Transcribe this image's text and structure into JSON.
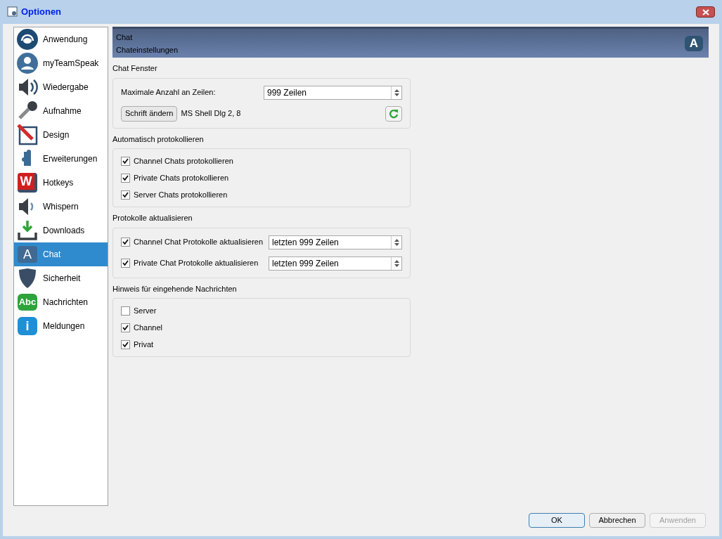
{
  "window": {
    "title": "Optionen"
  },
  "sidebar": {
    "items": [
      {
        "label": "Anwendung",
        "selected": false
      },
      {
        "label": "myTeamSpeak",
        "selected": false
      },
      {
        "label": "Wiedergabe",
        "selected": false
      },
      {
        "label": "Aufnahme",
        "selected": false
      },
      {
        "label": "Design",
        "selected": false
      },
      {
        "label": "Erweiterungen",
        "selected": false
      },
      {
        "label": "Hotkeys",
        "selected": false,
        "glyph": "W"
      },
      {
        "label": "Whispern",
        "selected": false
      },
      {
        "label": "Downloads",
        "selected": false
      },
      {
        "label": "Chat",
        "selected": true,
        "glyph": "A"
      },
      {
        "label": "Sicherheit",
        "selected": false
      },
      {
        "label": "Nachrichten",
        "selected": false,
        "glyph": "Abc"
      },
      {
        "label": "Meldungen",
        "selected": false,
        "glyph": "i"
      }
    ]
  },
  "header": {
    "title": "Chat",
    "subtitle": "Chateinstellungen",
    "glyph": "A"
  },
  "sections": [
    {
      "title": "Chat Fenster",
      "rows": [
        {
          "kind": "spin",
          "label": "Maximale Anzahl an Zeilen:",
          "value": "999 Zeilen"
        },
        {
          "kind": "font",
          "button": "Schrift ändern",
          "value": "MS Shell Dlg 2, 8"
        }
      ]
    },
    {
      "title": "Automatisch protokollieren",
      "rows": [
        {
          "kind": "check",
          "label": "Channel Chats protokollieren",
          "checked": true
        },
        {
          "kind": "check",
          "label": "Private Chats protokollieren",
          "checked": true
        },
        {
          "kind": "check",
          "label": "Server Chats protokollieren",
          "checked": true
        }
      ]
    },
    {
      "title": "Protokolle aktualisieren",
      "rows": [
        {
          "kind": "checkspin",
          "label": "Channel Chat Protokolle aktualisieren",
          "checked": true,
          "value": "letzten 999 Zeilen"
        },
        {
          "kind": "checkspin",
          "label": "Private Chat Protokolle aktualisieren",
          "checked": true,
          "value": "letzten 999 Zeilen"
        }
      ]
    },
    {
      "title": "Hinweis für eingehende Nachrichten",
      "rows": [
        {
          "kind": "check",
          "label": "Server",
          "checked": false
        },
        {
          "kind": "check",
          "label": "Channel",
          "checked": true
        },
        {
          "kind": "check",
          "label": "Privat",
          "checked": true
        }
      ]
    }
  ],
  "buttons": [
    {
      "label": "OK",
      "disabled": false,
      "default": true
    },
    {
      "label": "Abbrechen",
      "disabled": false,
      "default": false
    },
    {
      "label": "Anwenden",
      "disabled": true,
      "default": false
    }
  ]
}
